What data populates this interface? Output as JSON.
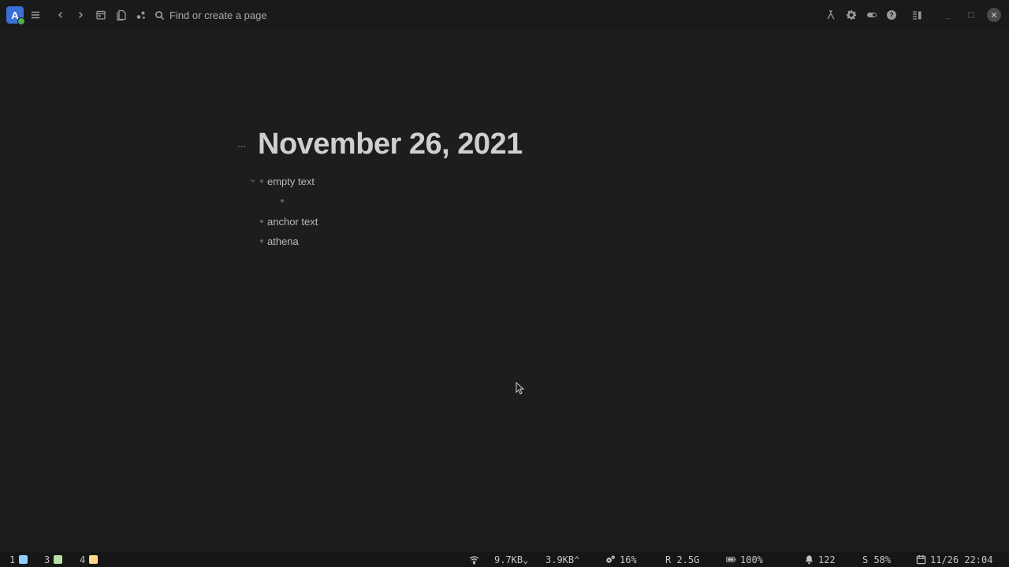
{
  "topbar": {
    "app_letter": "A",
    "search_placeholder": "Find or create a page",
    "icons": [
      "app-logo",
      "menu-icon",
      "back-icon",
      "forward-icon",
      "calendar-icon",
      "pages-icon",
      "graph-icon",
      "search-icon",
      "sync-icon",
      "settings-icon",
      "toggle-icon",
      "help-icon",
      "sidebar-icon"
    ]
  },
  "page": {
    "title": "November 26, 2021",
    "menu_glyph": "···",
    "blocks": [
      {
        "text": "empty text"
      },
      {
        "text": ""
      },
      {
        "text": "anchor text"
      },
      {
        "text": "athena"
      }
    ]
  },
  "statusbar": {
    "workspaces": [
      {
        "num": "1",
        "color": "#8ecfff"
      },
      {
        "num": "3",
        "color": "#b8e0a0"
      },
      {
        "num": "4",
        "color": "#ffd98a"
      }
    ],
    "net_down": "9.7KB⌄",
    "net_up": "3.9KB⌃",
    "cpu": "16%",
    "ram": "R 2.5G",
    "battery": "100%",
    "notifications": "122",
    "storage": "S 58%",
    "datetime": "11/26 22:04"
  }
}
